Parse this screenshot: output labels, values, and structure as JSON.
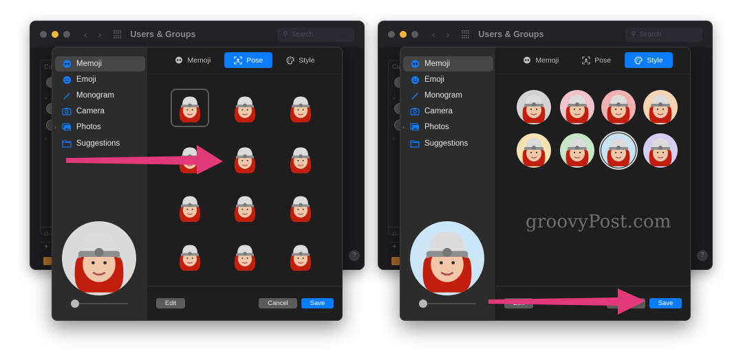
{
  "background_window": {
    "title": "Users & Groups",
    "search_placeholder": "Search",
    "list_header_stub": "Cu",
    "help_label": "?"
  },
  "sidebar": {
    "items": [
      {
        "label": "Memoji",
        "icon": "memoji-icon",
        "active": true
      },
      {
        "label": "Emoji",
        "icon": "emoji-icon"
      },
      {
        "label": "Monogram",
        "icon": "monogram-icon"
      },
      {
        "label": "Camera",
        "icon": "camera-icon"
      },
      {
        "label": "Photos",
        "icon": "photos-icon",
        "expandable": true
      },
      {
        "label": "Suggestions",
        "icon": "folder-icon"
      }
    ]
  },
  "tabs": [
    {
      "label": "Memoji",
      "icon": "memoji-icon"
    },
    {
      "label": "Pose",
      "icon": "pose-icon"
    },
    {
      "label": "Style",
      "icon": "style-icon"
    }
  ],
  "left_panel": {
    "active_tab": "Pose",
    "selected_pose_index": 0,
    "pose_count": 12,
    "preview_background": "#d9d9d9",
    "zoom_slider_value": 0
  },
  "right_panel": {
    "active_tab": "Style",
    "style_colors": [
      "#d3d3d3",
      "#f2c3cb",
      "#f2b0b0",
      "#f6d5b5",
      "#f6e2b0",
      "#c6e6c6",
      "#c8e4f4",
      "#d5cdf2"
    ],
    "selected_style_index": 6,
    "preview_background": "#cbe6f6",
    "zoom_slider_value": 0
  },
  "buttons": {
    "edit": "Edit",
    "cancel": "Cancel",
    "save": "Save"
  },
  "watermark": "groovyPost.com",
  "colors": {
    "accent": "#0a7cff",
    "annotation_arrow": "#e23a78"
  }
}
